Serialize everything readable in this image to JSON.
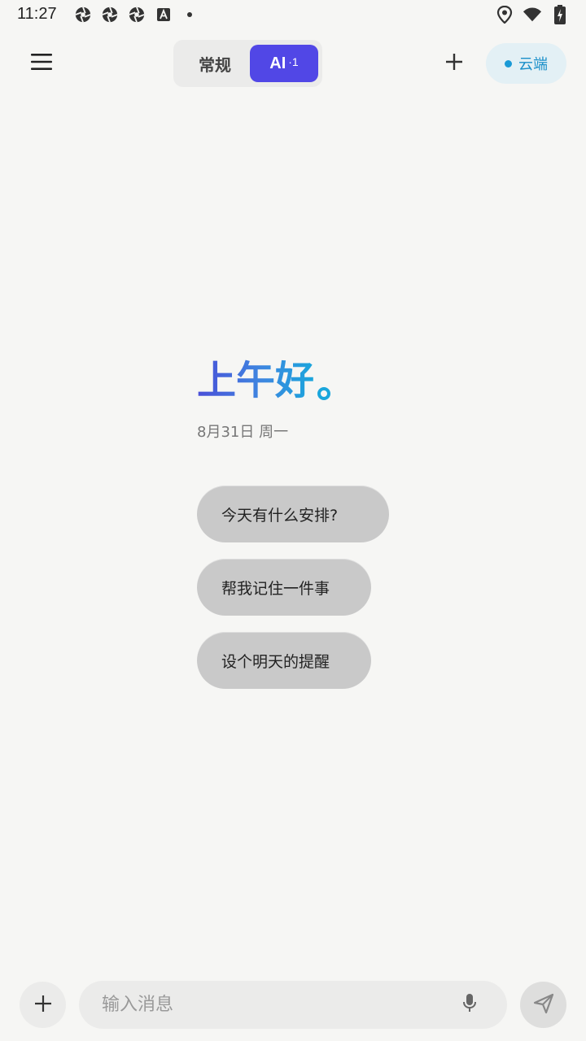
{
  "status_bar": {
    "time": "11:27",
    "left_icons": [
      "camera-shutter-icon",
      "camera-shutter-icon",
      "camera-shutter-icon",
      "text-a-icon",
      "notification-dot-icon"
    ],
    "right_icons": [
      "location-icon",
      "wifi-icon",
      "battery-charging-icon"
    ]
  },
  "header": {
    "menu_icon": "menu-icon",
    "tabs": [
      {
        "label": "常规",
        "active": false
      },
      {
        "label": "AI",
        "badge": "·1",
        "active": true
      }
    ],
    "add_icon": "plus-icon",
    "cloud_chip": {
      "label": "云端",
      "color": "#1a9ad6"
    }
  },
  "greeting": {
    "title": "上午好",
    "date": "8月31日 周一"
  },
  "suggestions": [
    {
      "label": "今天有什么安排?"
    },
    {
      "label": "帮我记住一件事"
    },
    {
      "label": "设个明天的提醒"
    }
  ],
  "input_bar": {
    "add_icon": "plus-icon",
    "placeholder": "输入消息",
    "mic_icon": "microphone-icon",
    "send_icon": "send-icon"
  },
  "colors": {
    "accent": "#5147e6",
    "greeting_start": "#4a4fd8",
    "greeting_end": "#1aa6dc",
    "background": "#f6f6f4"
  }
}
